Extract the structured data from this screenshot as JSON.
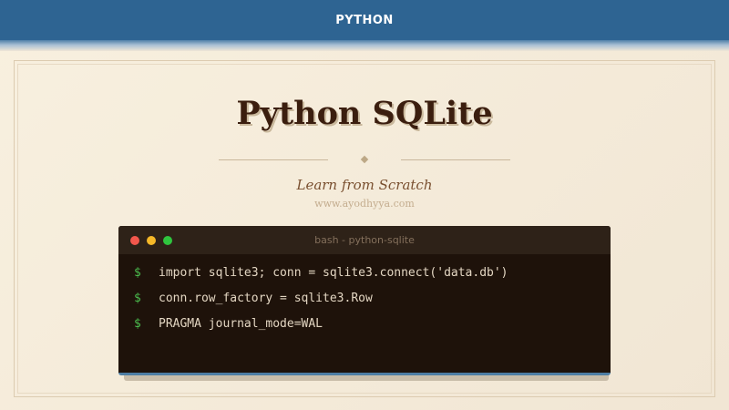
{
  "header": {
    "title": "PYTHON"
  },
  "main": {
    "title": "Python SQLite",
    "subtitle": "Learn from Scratch",
    "site": "www.ayodhyya.com"
  },
  "terminal": {
    "title": "bash - python-sqlite",
    "prompt": "$",
    "lines": [
      {
        "command": "import sqlite3; conn = sqlite3.connect('data.db')"
      },
      {
        "command": "conn.row_factory = sqlite3.Row"
      },
      {
        "command": "PRAGMA journal_mode=WAL"
      }
    ]
  },
  "colors": {
    "header_bg": "#2e6492",
    "page_bg": "#f8f0df",
    "title_text": "#3b1e0f",
    "terminal_bg": "#1e120a",
    "prompt_green": "#4bbd4e",
    "window_red": "#f2574c",
    "window_yellow": "#f5b828",
    "window_green": "#2fc53e"
  }
}
